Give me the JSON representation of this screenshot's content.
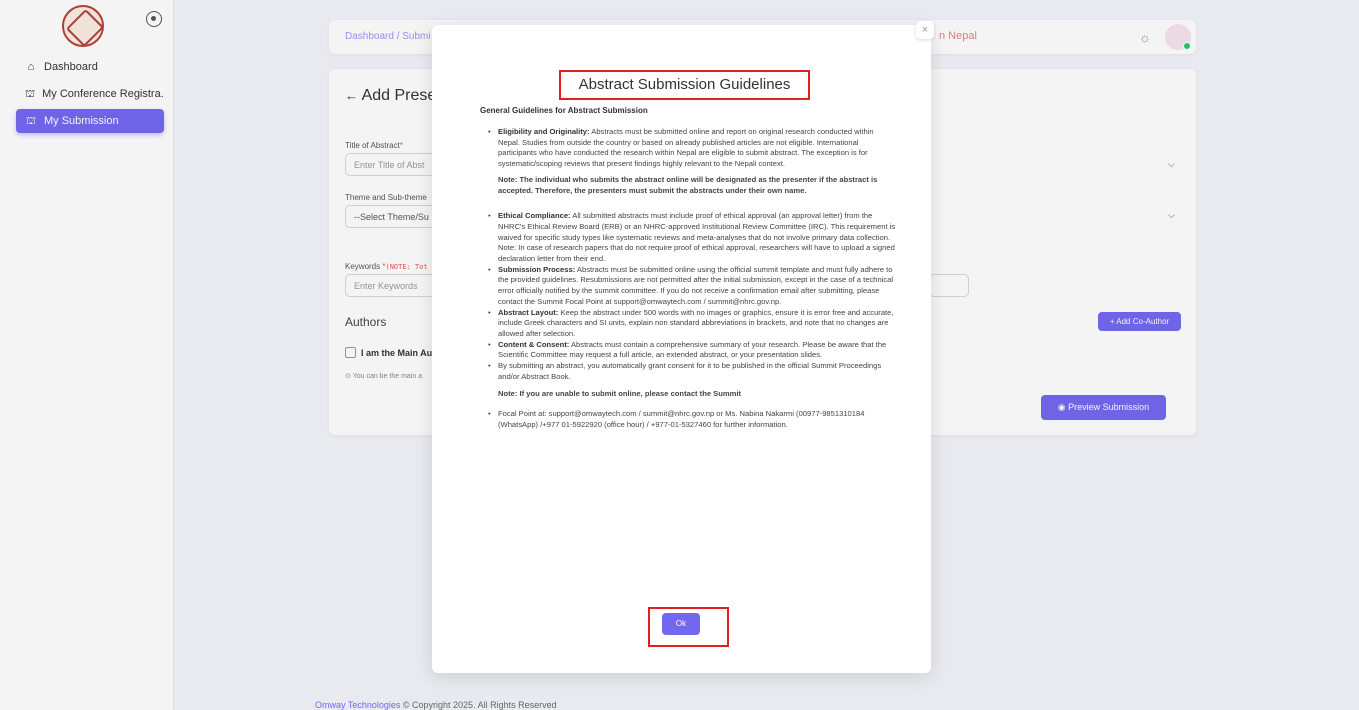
{
  "sidebar": {
    "items": [
      {
        "label": "Dashboard",
        "icon": "home-icon"
      },
      {
        "label": "My Conference Registra...",
        "icon": "building-icon"
      },
      {
        "label": "My Submission",
        "icon": "building-icon",
        "active": true
      }
    ]
  },
  "topbar": {
    "breadcrumb": "Dashboard / Submi",
    "title": "n Nepal"
  },
  "form": {
    "title": "Add Prese",
    "abstract_label": "Title of Abstract",
    "abstract_placeholder": "Enter Title of Abst",
    "theme_label": "Theme and Sub-theme",
    "theme_placeholder": "--Select Theme/Su",
    "keywords_label": "Keywords",
    "keywords_note": "(NOTE: Tot",
    "keywords_placeholder": "Enter Keywords",
    "authors_heading": "Authors",
    "main_author_label": "I am the Main Au",
    "helper_text": "You can be the main a",
    "add_coauthor": "+ Add Co-Author",
    "preview": "Preview Submission",
    "required_mark": "*"
  },
  "modal": {
    "close": "×",
    "title": "Abstract Submission Guidelines",
    "subtitle": "General Guidelines for Abstract Submission",
    "b1_title": "Eligibility and Originality:",
    "b1_text": " Abstracts must be submitted online and report on original research conducted within Nepal. Studies from outside the country or based on already published articles are not eligible. International participants who have conducted the research within Nepal are eligible to submit abstract. The exception is for systematic/scoping reviews that present findings highly relevant to the Nepali context.",
    "note1": "Note: The individual who submits the abstract online will be designated as the presenter if the abstract is accepted. Therefore, the presenters must submit the abstracts under their own name.",
    "b2_title": "Ethical Compliance:",
    "b2_text": " All submitted abstracts must include proof of ethical approval (an approval letter) from the NHRC's Ethical Review Board (ERB) or an NHRC-approved Institutional Review Committee (IRC). This requirement is waived for specific study types like systematic reviews and meta-analyses that do not involve primary data collection. Note: In case of research papers that do not require proof of ethical approval, researchers will have to upload a signed declaration letter from their end.",
    "b3_title": "Submission Process:",
    "b3_text": " Abstracts must be submitted online using the official summit template and must fully adhere to the provided guidelines. Resubmissions are not permitted after the initial submission, except in the case of a technical error officially notified by the summit committee. If you do not receive a confirmation email after submitting, please contact the Summit Focal Point at support@omwaytech.com / summit@nhrc.gov.np.",
    "b4_title": "Abstract Layout:",
    "b4_text": " Keep the abstract under 500 words with no images or graphics, ensure it is error free and accurate, include Greek characters and SI units, explain non standard abbreviations in brackets, and note that no changes are allowed after selection.",
    "b5_title": "Content & Consent:",
    "b5_text": " Abstracts must contain a comprehensive summary of your research. Please be aware that the Scientific Committee may request a full article, an extended abstract, or your presentation slides.",
    "b6_text": "By submitting an abstract, you automatically grant consent for it to be published in the official Summit Proceedings and/or Abstract Book.",
    "note2": "Note: If you are unable to submit online, please contact the Summit",
    "b7_text": "Focal Point at: support@omwaytech.com / summit@nhrc.gov.np or Ms. Nabina Nakarmi (00977-9851310184 (WhatsApp) /+977 01-5922920 (office hour) / +977-01-5327460 for further information.",
    "ok": "Ok"
  },
  "footer": {
    "brand": "Omway Technologies",
    "text": " © Copyright 2025. All Rights Reserved"
  },
  "colors": {
    "primary": "#7367f0",
    "highlight_box": "#e02020"
  }
}
